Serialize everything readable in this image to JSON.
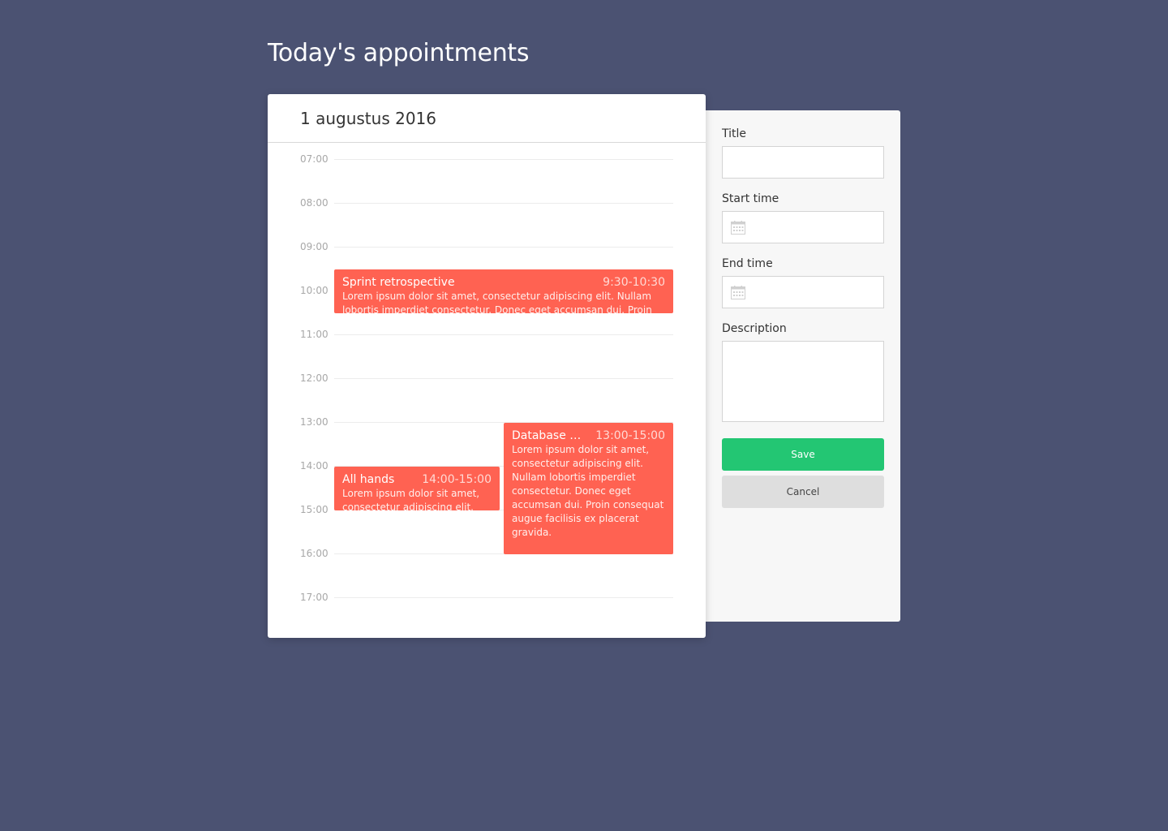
{
  "page": {
    "title": "Today's appointments"
  },
  "calendar": {
    "date": "1 augustus 2016",
    "hours": [
      "07:00",
      "08:00",
      "09:00",
      "10:00",
      "11:00",
      "12:00",
      "13:00",
      "14:00",
      "15:00",
      "16:00",
      "17:00"
    ],
    "events": [
      {
        "title": "Sprint retrospective",
        "time": "9:30-10:30",
        "description": "Lorem ipsum dolor sit amet, consectetur adipiscing elit. Nullam lobortis imperdiet consectetur. Donec eget accumsan dui. Proin consequat augue facilisis ex placerat gravida.",
        "color": "#ff6252"
      },
      {
        "title": "All hands",
        "time": "14:00-15:00",
        "description": "Lorem ipsum dolor sit amet, consectetur adipiscing elit.",
        "color": "#ff6252"
      },
      {
        "title": "Database migr...",
        "time": "13:00-15:00",
        "description": "Lorem ipsum dolor sit amet, consectetur adipiscing elit. Nullam lobortis imperdiet consectetur. Donec eget accumsan dui. Proin consequat augue facilisis ex placerat gravida.",
        "color": "#ff6252"
      }
    ]
  },
  "form": {
    "title_label": "Title",
    "title_value": "",
    "start_label": "Start time",
    "start_value": "",
    "end_label": "End time",
    "end_value": "",
    "description_label": "Description",
    "description_value": "",
    "save_label": "Save",
    "cancel_label": "Cancel",
    "calendar_icon": "calendar-icon"
  },
  "colors": {
    "background": "#4b5272",
    "event": "#ff6252",
    "save": "#23c673",
    "cancel": "#dedede",
    "panel": "#f7f7f7"
  }
}
